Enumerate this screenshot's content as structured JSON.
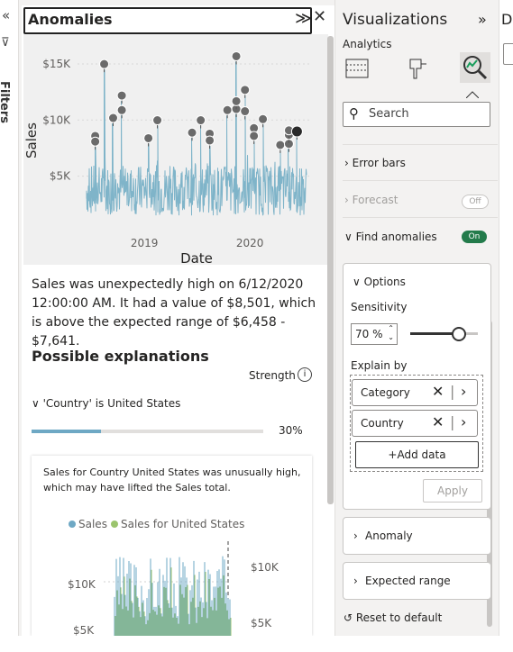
{
  "filters_pane": {
    "collapse_glyph": "«",
    "label": "Filters"
  },
  "anomalies": {
    "title": "Anomalies",
    "description": "Sales was unexpectedly high on 6/12/2020 12:00:00 AM. It had a value of $8,501, which is above the expected range of $6,458 - $7,641.",
    "possible_heading": "Possible explanations",
    "strength_label": "Strength",
    "explanation": {
      "label": "'Country' is United States",
      "percent_text": "30%",
      "percent": 0.3
    },
    "card": {
      "text": "Sales for Country United States was unusually high, which may have lifted the Sales total.",
      "legend": [
        "Sales",
        "Sales for United States"
      ],
      "left_ticks": [
        "$10K",
        "$5K"
      ],
      "right_ticks": [
        "$10K",
        "$5K"
      ]
    }
  },
  "chart_data": {
    "type": "line",
    "xlabel": "Date",
    "ylabel": "Sales",
    "x_ticks": [
      "2019",
      "2020"
    ],
    "y_ticks": [
      "$15K",
      "$10K",
      "$5K"
    ],
    "ylim": [
      0,
      17000
    ],
    "colors": {
      "line": "#7fb4c9",
      "marker": "#6b6b6b",
      "selected": "#2a2a2a"
    },
    "anomaly_points": [
      {
        "date": "2018-07",
        "y": 8100
      },
      {
        "date": "2018-07",
        "y": 7600
      },
      {
        "date": "2018-08",
        "y": 14500
      },
      {
        "date": "2018-09",
        "y": 9700
      },
      {
        "date": "2018-10",
        "y": 10400
      },
      {
        "date": "2018-10",
        "y": 11700
      },
      {
        "date": "2019-01",
        "y": 7900
      },
      {
        "date": "2019-02",
        "y": 9500
      },
      {
        "date": "2019-06",
        "y": 8400
      },
      {
        "date": "2019-07",
        "y": 9500
      },
      {
        "date": "2019-08",
        "y": 8300
      },
      {
        "date": "2019-08",
        "y": 7700
      },
      {
        "date": "2019-10",
        "y": 10400
      },
      {
        "date": "2019-11",
        "y": 10500
      },
      {
        "date": "2019-11",
        "y": 11200
      },
      {
        "date": "2019-11",
        "y": 15200
      },
      {
        "date": "2019-12",
        "y": 10300
      },
      {
        "date": "2019-12",
        "y": 12200
      },
      {
        "date": "2020-01",
        "y": 8800
      },
      {
        "date": "2020-01",
        "y": 8100
      },
      {
        "date": "2020-02",
        "y": 9600
      },
      {
        "date": "2020-04",
        "y": 7300
      },
      {
        "date": "2020-05",
        "y": 7400
      },
      {
        "date": "2020-05",
        "y": 8200
      },
      {
        "date": "2020-05",
        "y": 8600
      },
      {
        "date": "2020-06-12",
        "y": 8501,
        "selected": true
      }
    ]
  },
  "visualizations": {
    "title": "Visualizations",
    "collapse_glyph": "»",
    "tab": "Analytics",
    "search_placeholder": "Search",
    "error_bars": "Error bars",
    "forecast": "Forecast",
    "forecast_toggle": "Off",
    "find_anomalies": "Find anomalies",
    "find_toggle": "On",
    "options": "Options",
    "sensitivity_label": "Sensitivity",
    "sensitivity_value": "70 %",
    "sensitivity": 0.7,
    "explain_by": "Explain by",
    "fields": [
      "Category",
      "Country"
    ],
    "add_data": "+Add data",
    "apply": "Apply",
    "anomaly": "Anomaly",
    "expected_range": "Expected range",
    "reset": "Reset to default"
  },
  "right_pane": {
    "label": "D"
  }
}
